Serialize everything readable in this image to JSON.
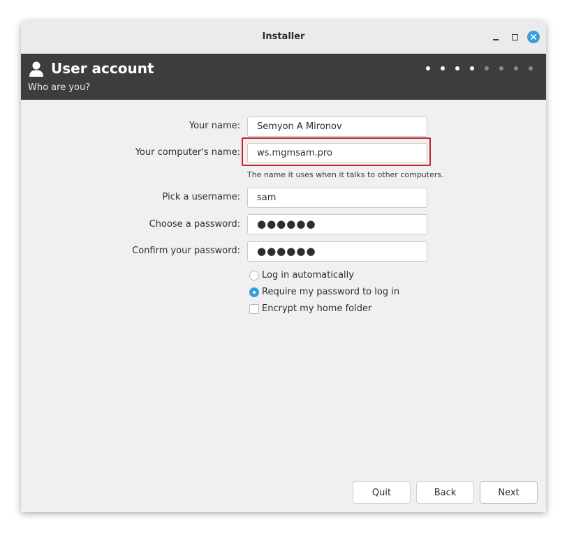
{
  "window": {
    "title": "Installer"
  },
  "header": {
    "title": "User account",
    "subtitle": "Who are you?",
    "progress_total": 8,
    "progress_done": 4
  },
  "form": {
    "name_label": "Your name:",
    "name_value": "Semyon A Mironov",
    "computer_label": "Your computer's name:",
    "computer_value": "ws.mgmsam.pro",
    "computer_hint": "The name it uses when it talks to other computers.",
    "username_label": "Pick a username:",
    "username_value": "sam",
    "password_label": "Choose a password:",
    "password_value": "●●●●●●",
    "confirm_label": "Confirm your password:",
    "confirm_value": "●●●●●●"
  },
  "options": {
    "login_auto": "Log in automatically",
    "require_password": "Require my password to log in",
    "encrypt_home": "Encrypt my home folder",
    "selected": "require_password"
  },
  "buttons": {
    "quit": "Quit",
    "back": "Back",
    "next": "Next"
  },
  "colors": {
    "accent": "#35a0d8",
    "header_bg": "#3d3d3d",
    "highlight": "#c4262b"
  }
}
